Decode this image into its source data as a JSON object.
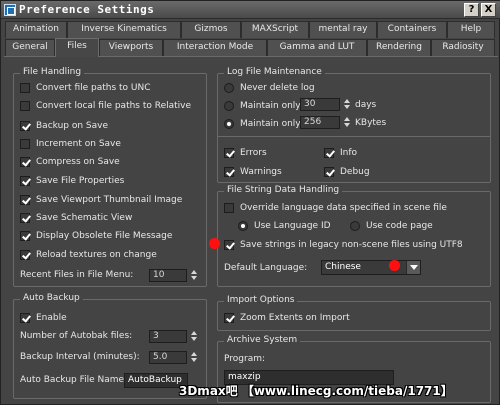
{
  "window": {
    "title": "Preference Settings",
    "help_label": "?",
    "close_label": "X"
  },
  "tabs_row1": [
    "Animation",
    "Inverse Kinematics",
    "Gizmos",
    "MAXScript",
    "mental ray",
    "Containers",
    "Help"
  ],
  "tabs_row2": [
    "General",
    "Files",
    "Viewports",
    "Interaction Mode",
    "Gamma and LUT",
    "Rendering",
    "Radiosity"
  ],
  "active_tab": "Files",
  "file_handling": {
    "title": "File Handling",
    "items": [
      {
        "label": "Convert file paths to UNC",
        "checked": false
      },
      {
        "label": "Convert local file paths to Relative",
        "checked": false
      },
      {
        "label": "Backup on Save",
        "checked": true
      },
      {
        "label": "Increment on Save",
        "checked": false
      },
      {
        "label": "Compress on Save",
        "checked": true
      },
      {
        "label": "Save File Properties",
        "checked": true
      },
      {
        "label": "Save Viewport Thumbnail Image",
        "checked": true
      },
      {
        "label": "Save Schematic View",
        "checked": true
      },
      {
        "label": "Display Obsolete File Message",
        "checked": true
      },
      {
        "label": "Reload textures on change",
        "checked": true
      }
    ],
    "recent_label": "Recent Files in File Menu:",
    "recent_value": "10"
  },
  "auto_backup": {
    "title": "Auto Backup",
    "enable_label": "Enable",
    "enable_checked": true,
    "num_files_label": "Number of Autobak files:",
    "num_files_value": "3",
    "interval_label": "Backup Interval (minutes):",
    "interval_value": "5.0",
    "file_name_label": "Auto Backup File Name:",
    "file_name_value": "AutoBackup"
  },
  "log_file": {
    "title": "Log File Maintenance",
    "never_label": "Never delete log",
    "maintain_days_label": "Maintain only",
    "maintain_days_value": "30",
    "days_unit": "days",
    "maintain_kb_label": "Maintain only",
    "maintain_kb_value": "256",
    "kb_unit": "KBytes",
    "selected_option": "maintain_kb",
    "errors_label": "Errors",
    "errors_checked": true,
    "info_label": "Info",
    "info_checked": true,
    "warnings_label": "Warnings",
    "warnings_checked": true,
    "debug_label": "Debug",
    "debug_checked": true
  },
  "file_string": {
    "title": "File String Data Handling",
    "override_label": "Override language data specified in scene file",
    "override_checked": false,
    "use_language_id_label": "Use Language ID",
    "use_code_page_label": "Use code page",
    "selected_option": "language_id",
    "legacy_label": "Save strings in legacy non-scene files using UTF8",
    "legacy_checked": true,
    "default_language_label": "Default Language:",
    "default_language_value": "Chinese"
  },
  "import_options": {
    "title": "Import Options",
    "zoom_label": "Zoom Extents on Import",
    "zoom_checked": true
  },
  "archive": {
    "title": "Archive System",
    "program_label": "Program:",
    "program_value": "maxzip"
  },
  "watermark": "3Dmax吧 【www.linecg.com/tieba/1771】",
  "colors": {
    "panel_bg": "#444444",
    "highlight_dot": "#ff1010"
  }
}
